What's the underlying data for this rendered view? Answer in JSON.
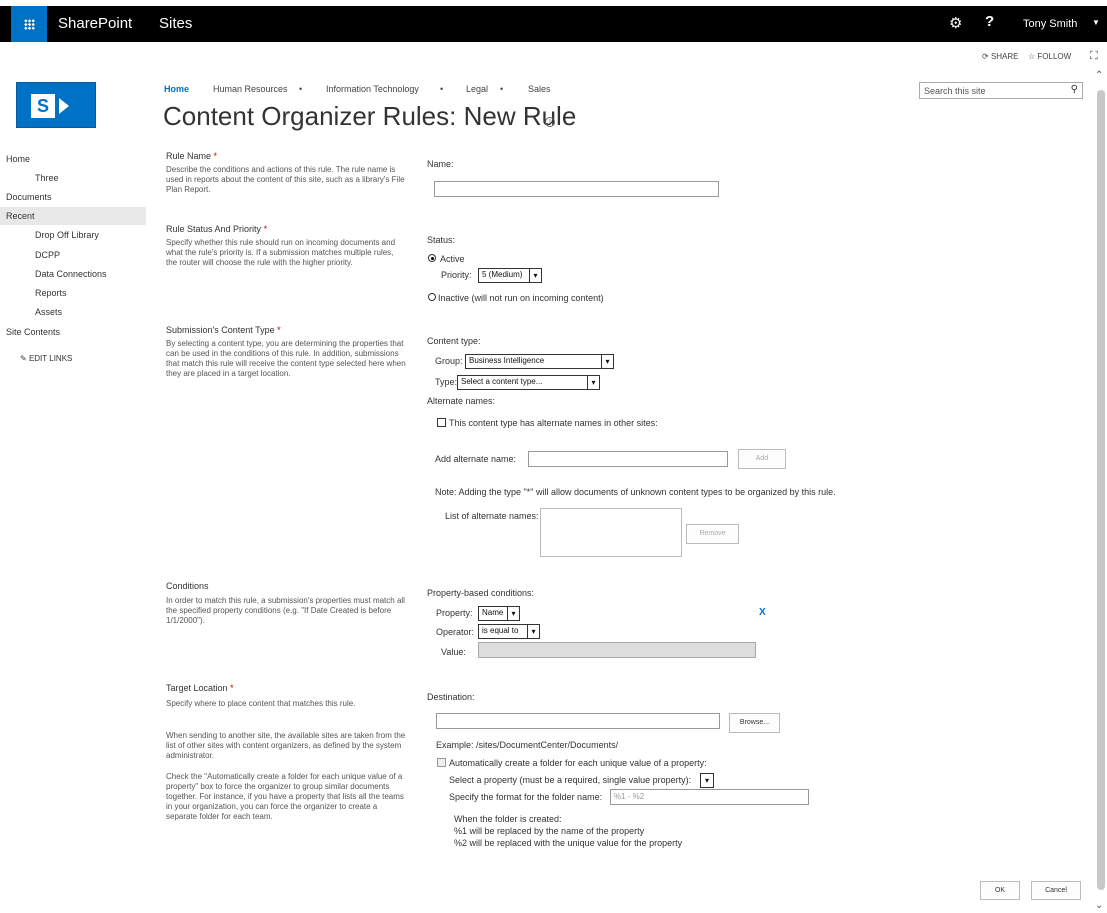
{
  "suitebar": {
    "brand": "SharePoint",
    "sites": "Sites",
    "user": "Tony Smith",
    "gear_icon": "gear-icon",
    "help_label": "?"
  },
  "actions": {
    "share": "SHARE",
    "follow": "FOLLOW"
  },
  "topnav": {
    "items": [
      "Home",
      "Human Resources",
      "Information Technology",
      "Legal",
      "Sales"
    ]
  },
  "page": {
    "title": "Content Organizer Rules: New Rule"
  },
  "search": {
    "placeholder": "Search this site"
  },
  "leftnav": {
    "items": [
      "Home",
      "Three",
      "Documents",
      "Recent",
      "Drop Off Library",
      "DCPP",
      "Data Connections",
      "Reports",
      "Assets",
      "Site Contents"
    ],
    "edit_links": "EDIT LINKS"
  },
  "sections": {
    "rule_name": {
      "title": "Rule Name",
      "desc": "Describe the conditions and actions of this rule. The rule name is used in reports about the content of this site, such as a library's File Plan Report.",
      "name_label": "Name:",
      "name_value": ""
    },
    "status": {
      "title": "Rule Status And Priority",
      "desc": "Specify whether this rule should run on incoming documents and what the rule's priority is. If a submission matches multiple rules, the router will choose the rule with the higher priority.",
      "status_label": "Status:",
      "active_label": "Active",
      "priority_label": "Priority:",
      "priority_value": "5 (Medium)",
      "inactive_label": "Inactive (will not run on incoming content)"
    },
    "content_type": {
      "title": "Submission's Content Type",
      "desc": "By selecting a content type, you are determining the properties that can be used in the conditions of this rule. In addition, submissions that match this rule will receive the content type selected here when they are placed in a target location.",
      "ct_label": "Content type:",
      "group_label": "Group:",
      "group_value": "Business Intelligence",
      "type_label": "Type:",
      "type_value": "Select a content type...",
      "alt_names_label": "Alternate names:",
      "alt_check_label": "This content type has alternate names in other sites:",
      "add_alt_label": "Add alternate name:",
      "add_button": "Add",
      "note": "Note: Adding the type \"*\" will allow documents of unknown content types to be organized by this rule.",
      "list_label": "List of alternate names:",
      "remove_button": "Remove"
    },
    "conditions": {
      "title": "Conditions",
      "desc": "In order to match this rule, a submission's properties must match all the specified property conditions (e.g. \"If Date Created is before 1/1/2000\").",
      "pb_label": "Property-based conditions:",
      "property_label": "Property:",
      "property_value": "Name",
      "operator_label": "Operator:",
      "operator_value": "is equal to",
      "value_label": "Value:",
      "remove_x": "X"
    },
    "target": {
      "title": "Target Location",
      "desc1": "Specify where to place content that matches this rule.",
      "desc2": "When sending to another site, the available sites are taken from the list of other sites with content organizers, as defined by the system administrator.",
      "desc3": "Check the \"Automatically create a folder for each unique value of a property\" box to force the organizer to group similar documents together. For instance, if you have a property that lists all the teams in your organization, you can force the organizer to create a separate folder for each team.",
      "dest_label": "Destination:",
      "browse_button": "Browse...",
      "example": "Example: /sites/DocumentCenter/Documents/",
      "auto_folder_label": "Automatically create a folder for each unique value of a property:",
      "select_prop_label": "Select a property (must be a required, single value property):",
      "format_label": "Specify the format for the folder name:",
      "format_value": "%1 - %2",
      "when_created": "When the folder is created:",
      "pct1": "%1 will be replaced by the name of the property",
      "pct2": "%2 will be replaced with the unique value for the property"
    }
  },
  "footer": {
    "ok": "OK",
    "cancel": "Cancel"
  },
  "colors": {
    "suite": "#000000",
    "accent": "#0072c6",
    "required": "#cc0000"
  }
}
